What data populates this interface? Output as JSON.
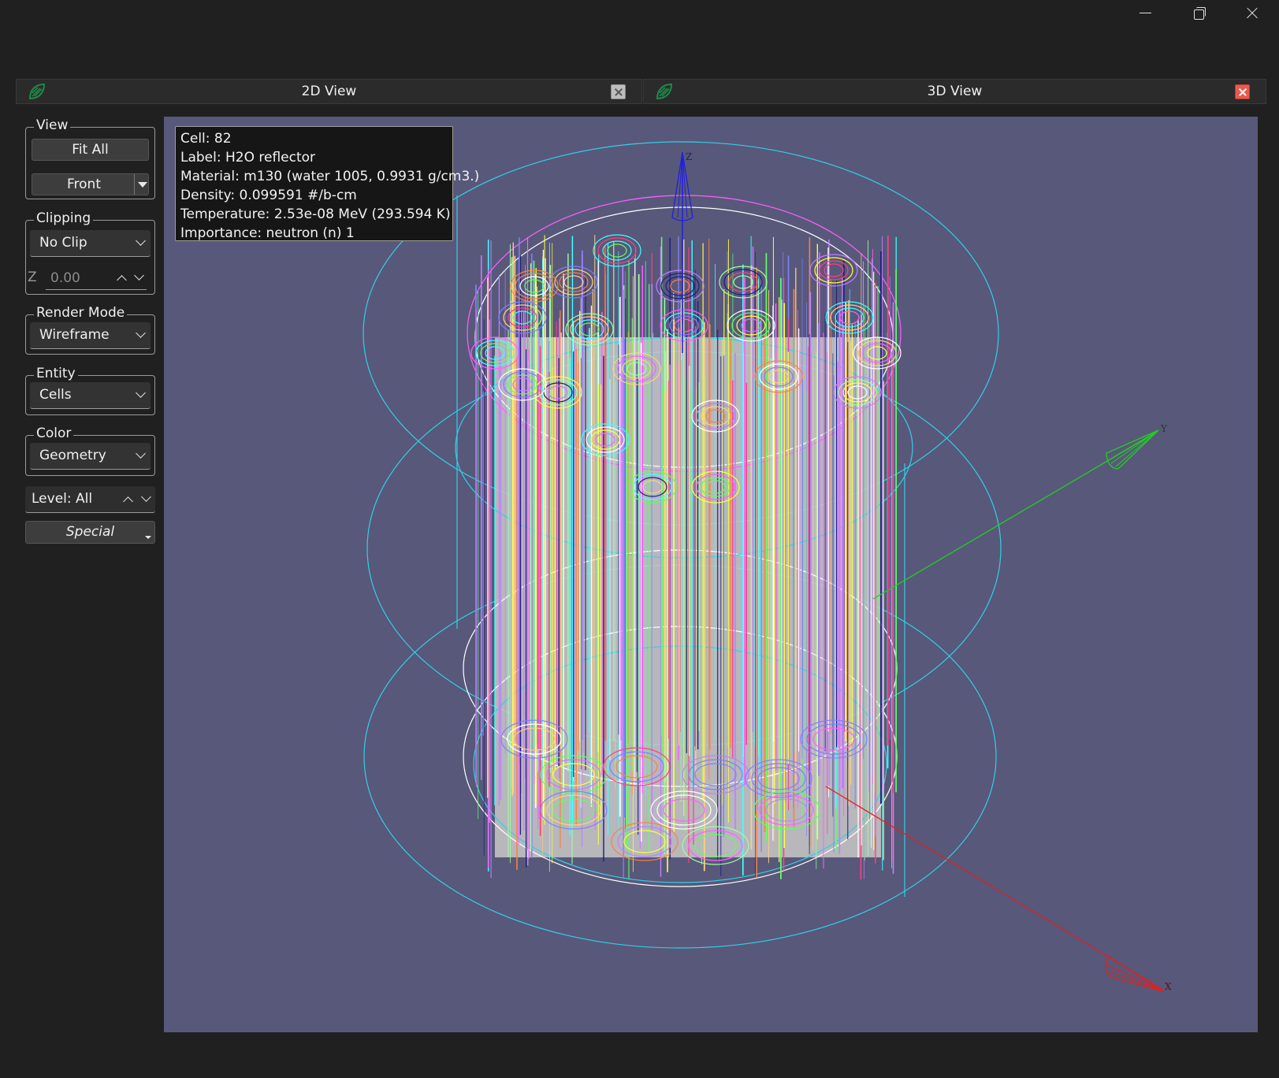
{
  "window": {
    "controls": [
      "minimize",
      "maximize",
      "close"
    ]
  },
  "tabs": [
    {
      "label": "2D View",
      "icon": "app-leaf-icon"
    },
    {
      "label": "3D View",
      "icon": "app-leaf-icon"
    }
  ],
  "panel": {
    "view": {
      "title": "View",
      "fit_all": "Fit All",
      "direction": "Front"
    },
    "clipping": {
      "title": "Clipping",
      "mode": "No Clip",
      "axis_label": "Z",
      "value": "0.00"
    },
    "render_mode": {
      "title": "Render Mode",
      "value": "Wireframe"
    },
    "entity": {
      "title": "Entity",
      "value": "Cells"
    },
    "color": {
      "title": "Color",
      "value": "Geometry"
    },
    "level": {
      "value": "Level: All"
    },
    "special": {
      "label": "Special"
    }
  },
  "viewport": {
    "background": "#58587a",
    "axes": {
      "x": "X",
      "y": "Y",
      "z": "Z"
    },
    "axis_colors": {
      "x": "#e02020",
      "y": "#20d020",
      "z": "#2020e0"
    }
  },
  "tooltip": {
    "cell": "Cell: 82",
    "label": "Label: H2O reflector",
    "material": "Material: m130 (water 1005, 0.9931 g/cm3.)",
    "density": "Density: 0.099591 #/b-cm",
    "temperature": "Temperature: 2.53e-08 MeV (293.594 K)",
    "importance": "Importance: neutron (n) 1"
  }
}
